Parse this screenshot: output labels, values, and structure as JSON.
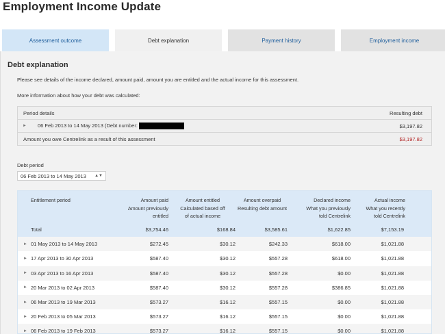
{
  "page_title": "Employment Income Update",
  "tabs": [
    {
      "label": "Assessment outcome"
    },
    {
      "label": "Debt explanation"
    },
    {
      "label": "Payment history"
    },
    {
      "label": "Employment income"
    }
  ],
  "section": {
    "heading": "Debt explanation",
    "intro": "Please see details of the income declared, amount paid, amount you are entitled and the actual income for this assessment.",
    "more_info": "More information about how your debt was calculated:"
  },
  "period_box": {
    "header_left": "Period details",
    "header_right": "Resulting debt",
    "period_text": "06 Feb 2013 to 14 May 2013 (Debt number:",
    "period_debt": "$3,197.82",
    "owe_label": "Amount you owe Centrelink as a result of this assessment",
    "owe_value": "$3,197.82",
    "owe_color": "#b22222"
  },
  "debt_period": {
    "label": "Debt period",
    "selected": "06 Feb 2013 to 14 May 2013"
  },
  "table": {
    "headers": [
      {
        "line1": "Entitlement period",
        "line2": "",
        "line3": ""
      },
      {
        "line1": "Amount paid",
        "line2": "Amount previously",
        "line3": "entitled"
      },
      {
        "line1": "Amount entitled",
        "line2": "Calculated based off",
        "line3": "of actual income"
      },
      {
        "line1": "Amount overpaid",
        "line2": "Resulting debt amount",
        "line3": ""
      },
      {
        "line1": "Declared income",
        "line2": "What you previously",
        "line3": "told Centrelink"
      },
      {
        "line1": "Actual income",
        "line2": "What you recently",
        "line3": "told Centrelink"
      }
    ],
    "total": {
      "label": "Total",
      "paid": "$3,754.46",
      "entitled": "$168.84",
      "overpaid": "$3,585.61",
      "declared": "$1,622.85",
      "actual": "$7,153.19"
    },
    "rows": [
      {
        "period": "01 May 2013 to 14 May 2013",
        "paid": "$272.45",
        "entitled": "$30.12",
        "overpaid": "$242.33",
        "declared": "$618.00",
        "actual": "$1,021.88"
      },
      {
        "period": "17 Apr 2013 to 30 Apr 2013",
        "paid": "$587.40",
        "entitled": "$30.12",
        "overpaid": "$557.28",
        "declared": "$618.00",
        "actual": "$1,021.88"
      },
      {
        "period": "03 Apr 2013 to 16 Apr 2013",
        "paid": "$587.40",
        "entitled": "$30.12",
        "overpaid": "$557.28",
        "declared": "$0.00",
        "actual": "$1,021.88"
      },
      {
        "period": "20 Mar 2013 to 02 Apr 2013",
        "paid": "$587.40",
        "entitled": "$30.12",
        "overpaid": "$557.28",
        "declared": "$386.85",
        "actual": "$1,021.88"
      },
      {
        "period": "06 Mar 2013 to 19 Mar 2013",
        "paid": "$573.27",
        "entitled": "$16.12",
        "overpaid": "$557.15",
        "declared": "$0.00",
        "actual": "$1,021.88"
      },
      {
        "period": "20 Feb 2013 to 05 Mar 2013",
        "paid": "$573.27",
        "entitled": "$16.12",
        "overpaid": "$557.15",
        "declared": "$0.00",
        "actual": "$1,021.88"
      },
      {
        "period": "06 Feb 2013 to 19 Feb 2013",
        "paid": "$573.27",
        "entitled": "$16.12",
        "overpaid": "$557.15",
        "declared": "$0.00",
        "actual": "$1,021.88"
      }
    ]
  },
  "icons": {
    "row_caret": "caret-right-icon",
    "select_arrow": "select-arrows-icon"
  }
}
